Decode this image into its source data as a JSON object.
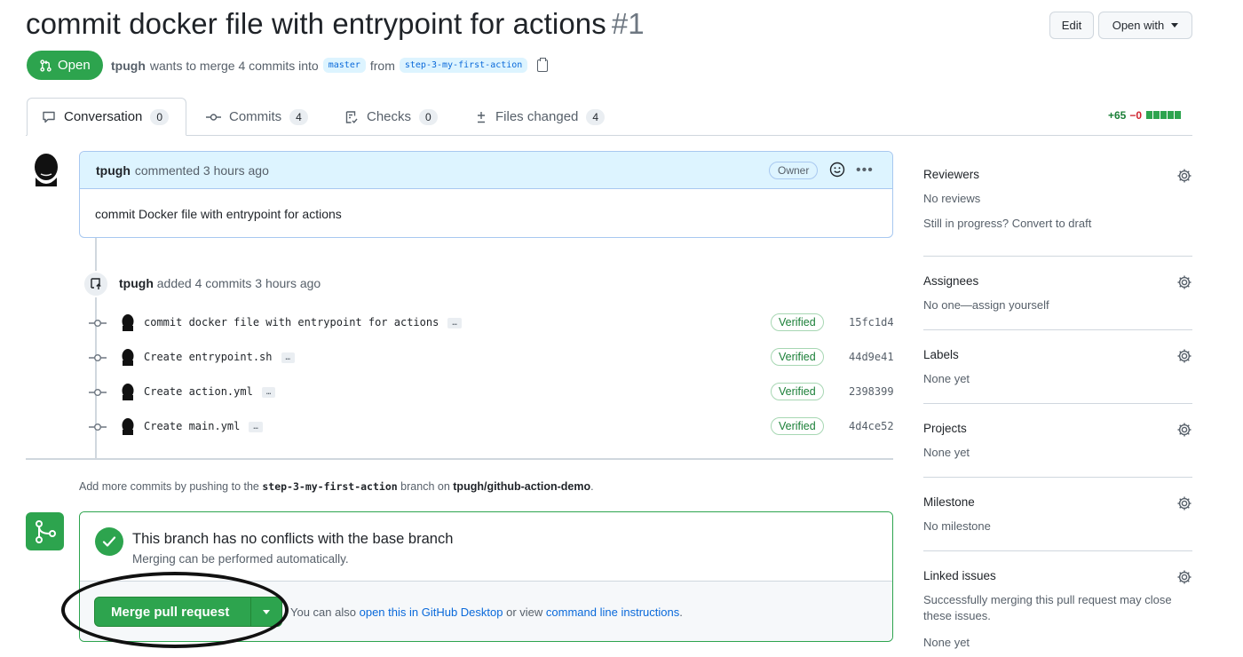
{
  "header": {
    "title": "commit docker file with entrypoint for actions",
    "number": "#1",
    "edit_label": "Edit",
    "open_with_label": "Open with"
  },
  "state": {
    "label": "Open",
    "author": "tpugh",
    "text_merge": "wants to merge 4 commits into",
    "base_branch": "master",
    "text_from": "from",
    "head_branch": "step-3-my-first-action"
  },
  "tabs": [
    {
      "label": "Conversation",
      "count": "0"
    },
    {
      "label": "Commits",
      "count": "4"
    },
    {
      "label": "Checks",
      "count": "0"
    },
    {
      "label": "Files changed",
      "count": "4"
    }
  ],
  "diffstat": {
    "additions": "+65",
    "deletions": "−0"
  },
  "comment": {
    "author": "tpugh",
    "action": "commented 3 hours ago",
    "role_badge": "Owner",
    "body": "commit Docker file with entrypoint for actions"
  },
  "push_event": {
    "author": "tpugh",
    "text": "added 4 commits 3 hours ago"
  },
  "commits": [
    {
      "message": "commit docker file with entrypoint for actions",
      "verified": "Verified",
      "sha": "15fc1d4"
    },
    {
      "message": "Create entrypoint.sh",
      "verified": "Verified",
      "sha": "44d9e41"
    },
    {
      "message": "Create action.yml",
      "verified": "Verified",
      "sha": "2398399"
    },
    {
      "message": "Create main.yml",
      "verified": "Verified",
      "sha": "4d4ce52"
    }
  ],
  "add_more": {
    "prefix": "Add more commits by pushing to the",
    "branch": "step-3-my-first-action",
    "middle": "branch on",
    "repo": "tpugh/github-action-demo",
    "suffix": "."
  },
  "merge": {
    "heading": "This branch has no conflicts with the base branch",
    "subtext": "Merging can be performed automatically.",
    "button_label": "Merge pull request",
    "hint_prefix": "You can also",
    "hint_link1": "open this in GitHub Desktop",
    "hint_middle": "or view",
    "hint_link2": "command line instructions",
    "hint_suffix": "."
  },
  "sidebar": {
    "reviewers": {
      "title": "Reviewers",
      "line1": "No reviews",
      "line2": "Still in progress? Convert to draft"
    },
    "assignees": {
      "title": "Assignees",
      "line1": "No one—assign yourself"
    },
    "labels": {
      "title": "Labels",
      "line1": "None yet"
    },
    "projects": {
      "title": "Projects",
      "line1": "None yet"
    },
    "milestone": {
      "title": "Milestone",
      "line1": "No milestone"
    },
    "linked_issues": {
      "title": "Linked issues",
      "line1": "Successfully merging this pull request may close these issues.",
      "line2": "None yet"
    }
  },
  "colors": {
    "open_green": "#2da44e",
    "link_blue": "#0969da",
    "comment_header_bg": "#ddf4ff",
    "text_muted": "#57606a"
  }
}
